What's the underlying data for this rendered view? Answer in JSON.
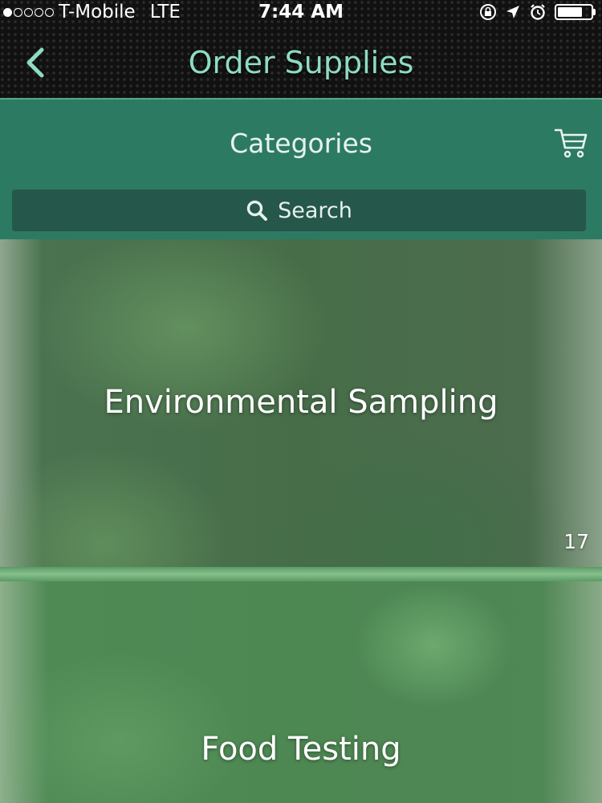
{
  "status_bar": {
    "carrier": "T-Mobile",
    "network": "LTE",
    "time": "7:44 AM",
    "signal_strength": "1 of 5",
    "battery_level": 0.75
  },
  "nav": {
    "title": "Order Supplies",
    "back_icon": "chevron-left-icon"
  },
  "header": {
    "title": "Categories",
    "cart_icon": "cart-icon"
  },
  "search": {
    "placeholder": "Search",
    "icon": "search-icon"
  },
  "categories": [
    {
      "label": "Environmental Sampling",
      "count": "17"
    },
    {
      "label": "Food Testing"
    }
  ],
  "colors": {
    "nav_title": "#8fdcc0",
    "header_bg": "#2d7a62",
    "search_bg": "#25574a"
  }
}
